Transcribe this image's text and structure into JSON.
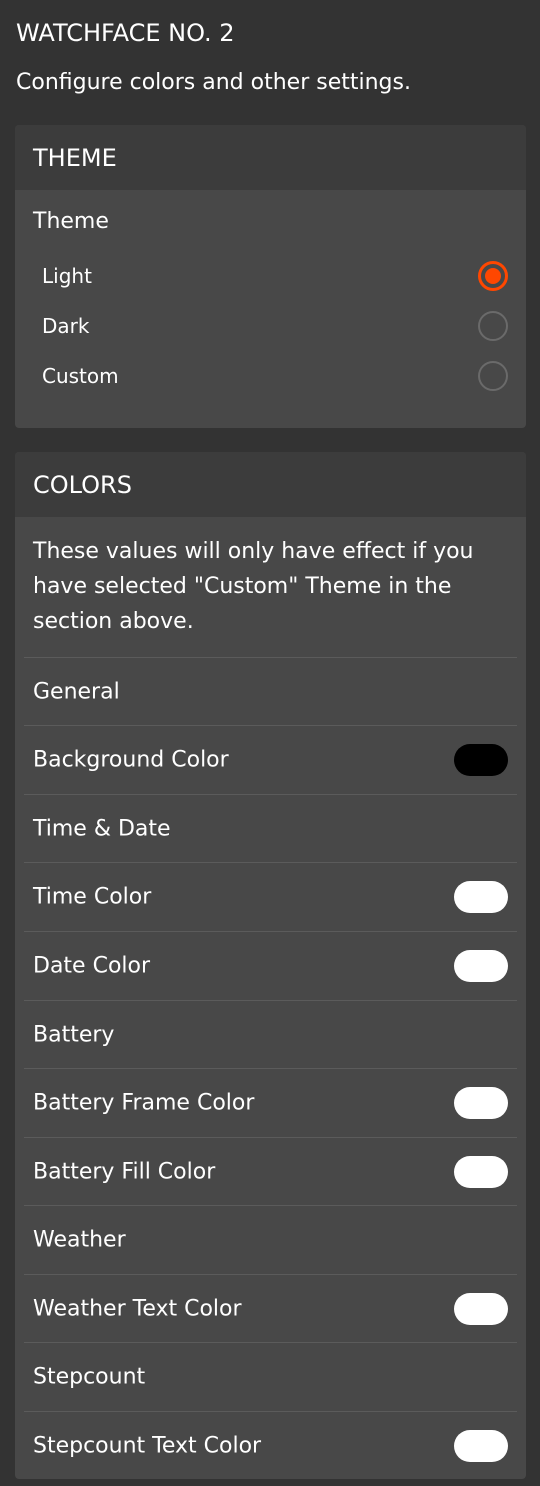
{
  "header": {
    "title": "WATCHFACE NO. 2",
    "subtitle": "Configure colors and other settings."
  },
  "theme_section": {
    "title": "THEME",
    "field_label": "Theme",
    "options": [
      {
        "label": "Light",
        "selected": true
      },
      {
        "label": "Dark",
        "selected": false
      },
      {
        "label": "Custom",
        "selected": false
      }
    ],
    "accent_color": "#ff4700"
  },
  "colors_section": {
    "title": "COLORS",
    "description": "These values will only have effect if you have selected \"Custom\" Theme in the section above.",
    "rows": [
      {
        "label": "General",
        "type": "heading"
      },
      {
        "label": "Background Color",
        "type": "color",
        "value": "#000000"
      },
      {
        "label": "Time & Date",
        "type": "heading"
      },
      {
        "label": "Time Color",
        "type": "color",
        "value": "#ffffff"
      },
      {
        "label": "Date Color",
        "type": "color",
        "value": "#ffffff"
      },
      {
        "label": "Battery",
        "type": "heading"
      },
      {
        "label": "Battery Frame Color",
        "type": "color",
        "value": "#ffffff"
      },
      {
        "label": "Battery Fill Color",
        "type": "color",
        "value": "#ffffff"
      },
      {
        "label": "Weather",
        "type": "heading"
      },
      {
        "label": "Weather Text Color",
        "type": "color",
        "value": "#ffffff"
      },
      {
        "label": "Stepcount",
        "type": "heading"
      },
      {
        "label": "Stepcount Text Color",
        "type": "color",
        "value": "#ffffff"
      }
    ]
  }
}
